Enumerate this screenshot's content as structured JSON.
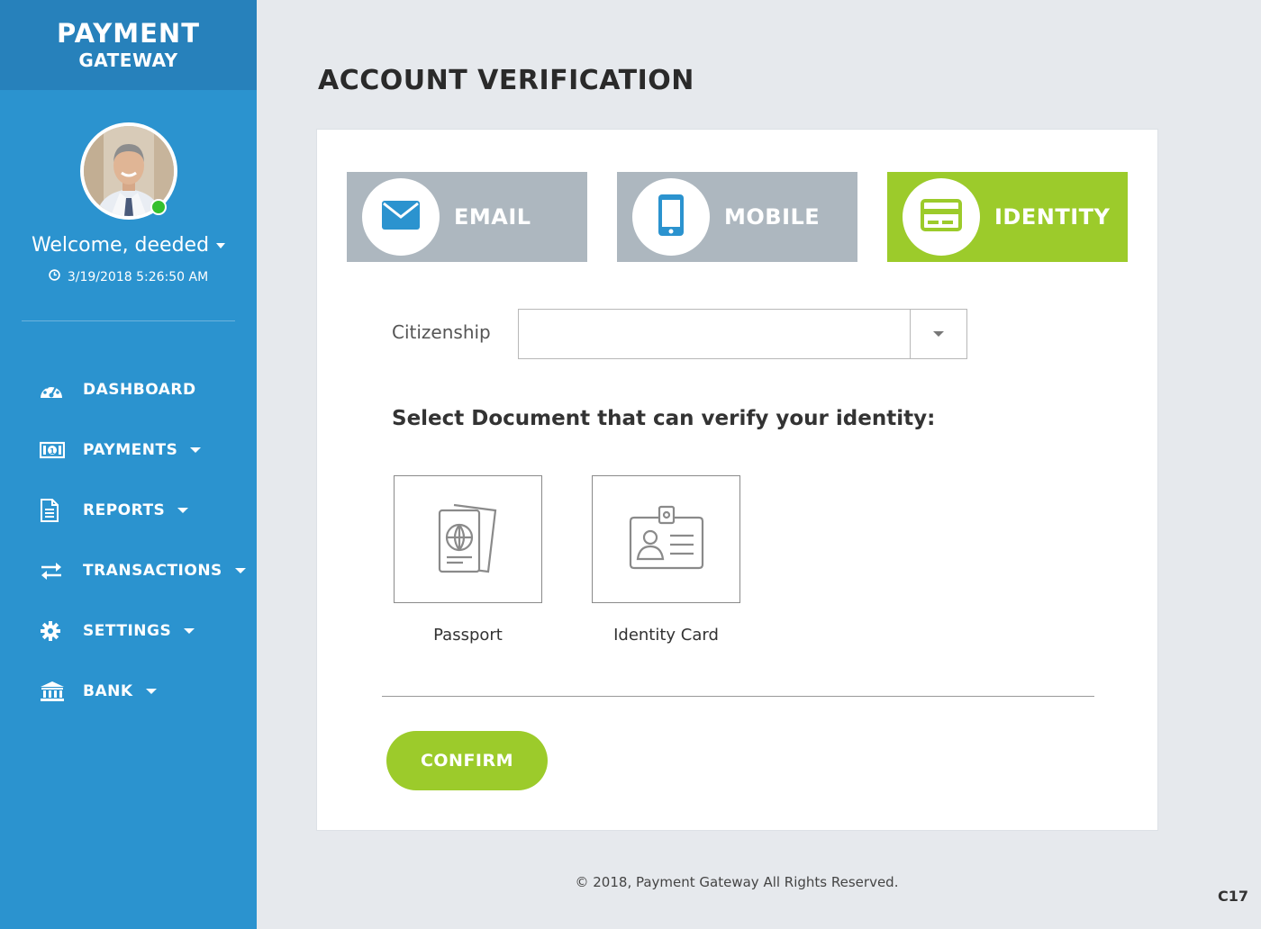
{
  "brand": {
    "line1": "PAYMENT",
    "line2": "GATEWAY"
  },
  "user": {
    "welcome": "Welcome, deeded",
    "datetime": "3/19/2018 5:26:50 AM",
    "status": "online"
  },
  "nav": {
    "items": [
      {
        "label": "DASHBOARD",
        "icon": "dashboard-icon",
        "has_caret": false
      },
      {
        "label": "PAYMENTS",
        "icon": "money-icon",
        "has_caret": true
      },
      {
        "label": "REPORTS",
        "icon": "document-icon",
        "has_caret": true
      },
      {
        "label": "TRANSACTIONS",
        "icon": "exchange-icon",
        "has_caret": true
      },
      {
        "label": "SETTINGS",
        "icon": "gear-icon",
        "has_caret": true
      },
      {
        "label": "BANK",
        "icon": "bank-icon",
        "has_caret": true
      }
    ]
  },
  "page": {
    "title": "ACCOUNT VERIFICATION"
  },
  "steps": [
    {
      "label": "EMAIL",
      "icon": "envelope-icon",
      "active": false
    },
    {
      "label": "MOBILE",
      "icon": "mobile-phone-icon",
      "active": false
    },
    {
      "label": "IDENTITY",
      "icon": "id-card-icon",
      "active": true
    }
  ],
  "form": {
    "citizenship_label": "Citizenship",
    "citizenship_value": "",
    "doc_heading": "Select Document that can verify your identity:",
    "documents": [
      {
        "label": "Passport",
        "icon": "passport-icon"
      },
      {
        "label": "Identity Card",
        "icon": "badge-id-icon"
      }
    ],
    "confirm_label": "CONFIRM"
  },
  "footer": {
    "copyright": "© 2018, Payment Gateway All Rights Reserved.",
    "code": "C17"
  },
  "colors": {
    "sidebar": "#2b93cf",
    "brand_bar": "#2781bb",
    "accent_green": "#9ccb2b",
    "inactive_step": "#adb7bf",
    "icon_blue": "#2b93cf",
    "online": "#35c02e"
  }
}
